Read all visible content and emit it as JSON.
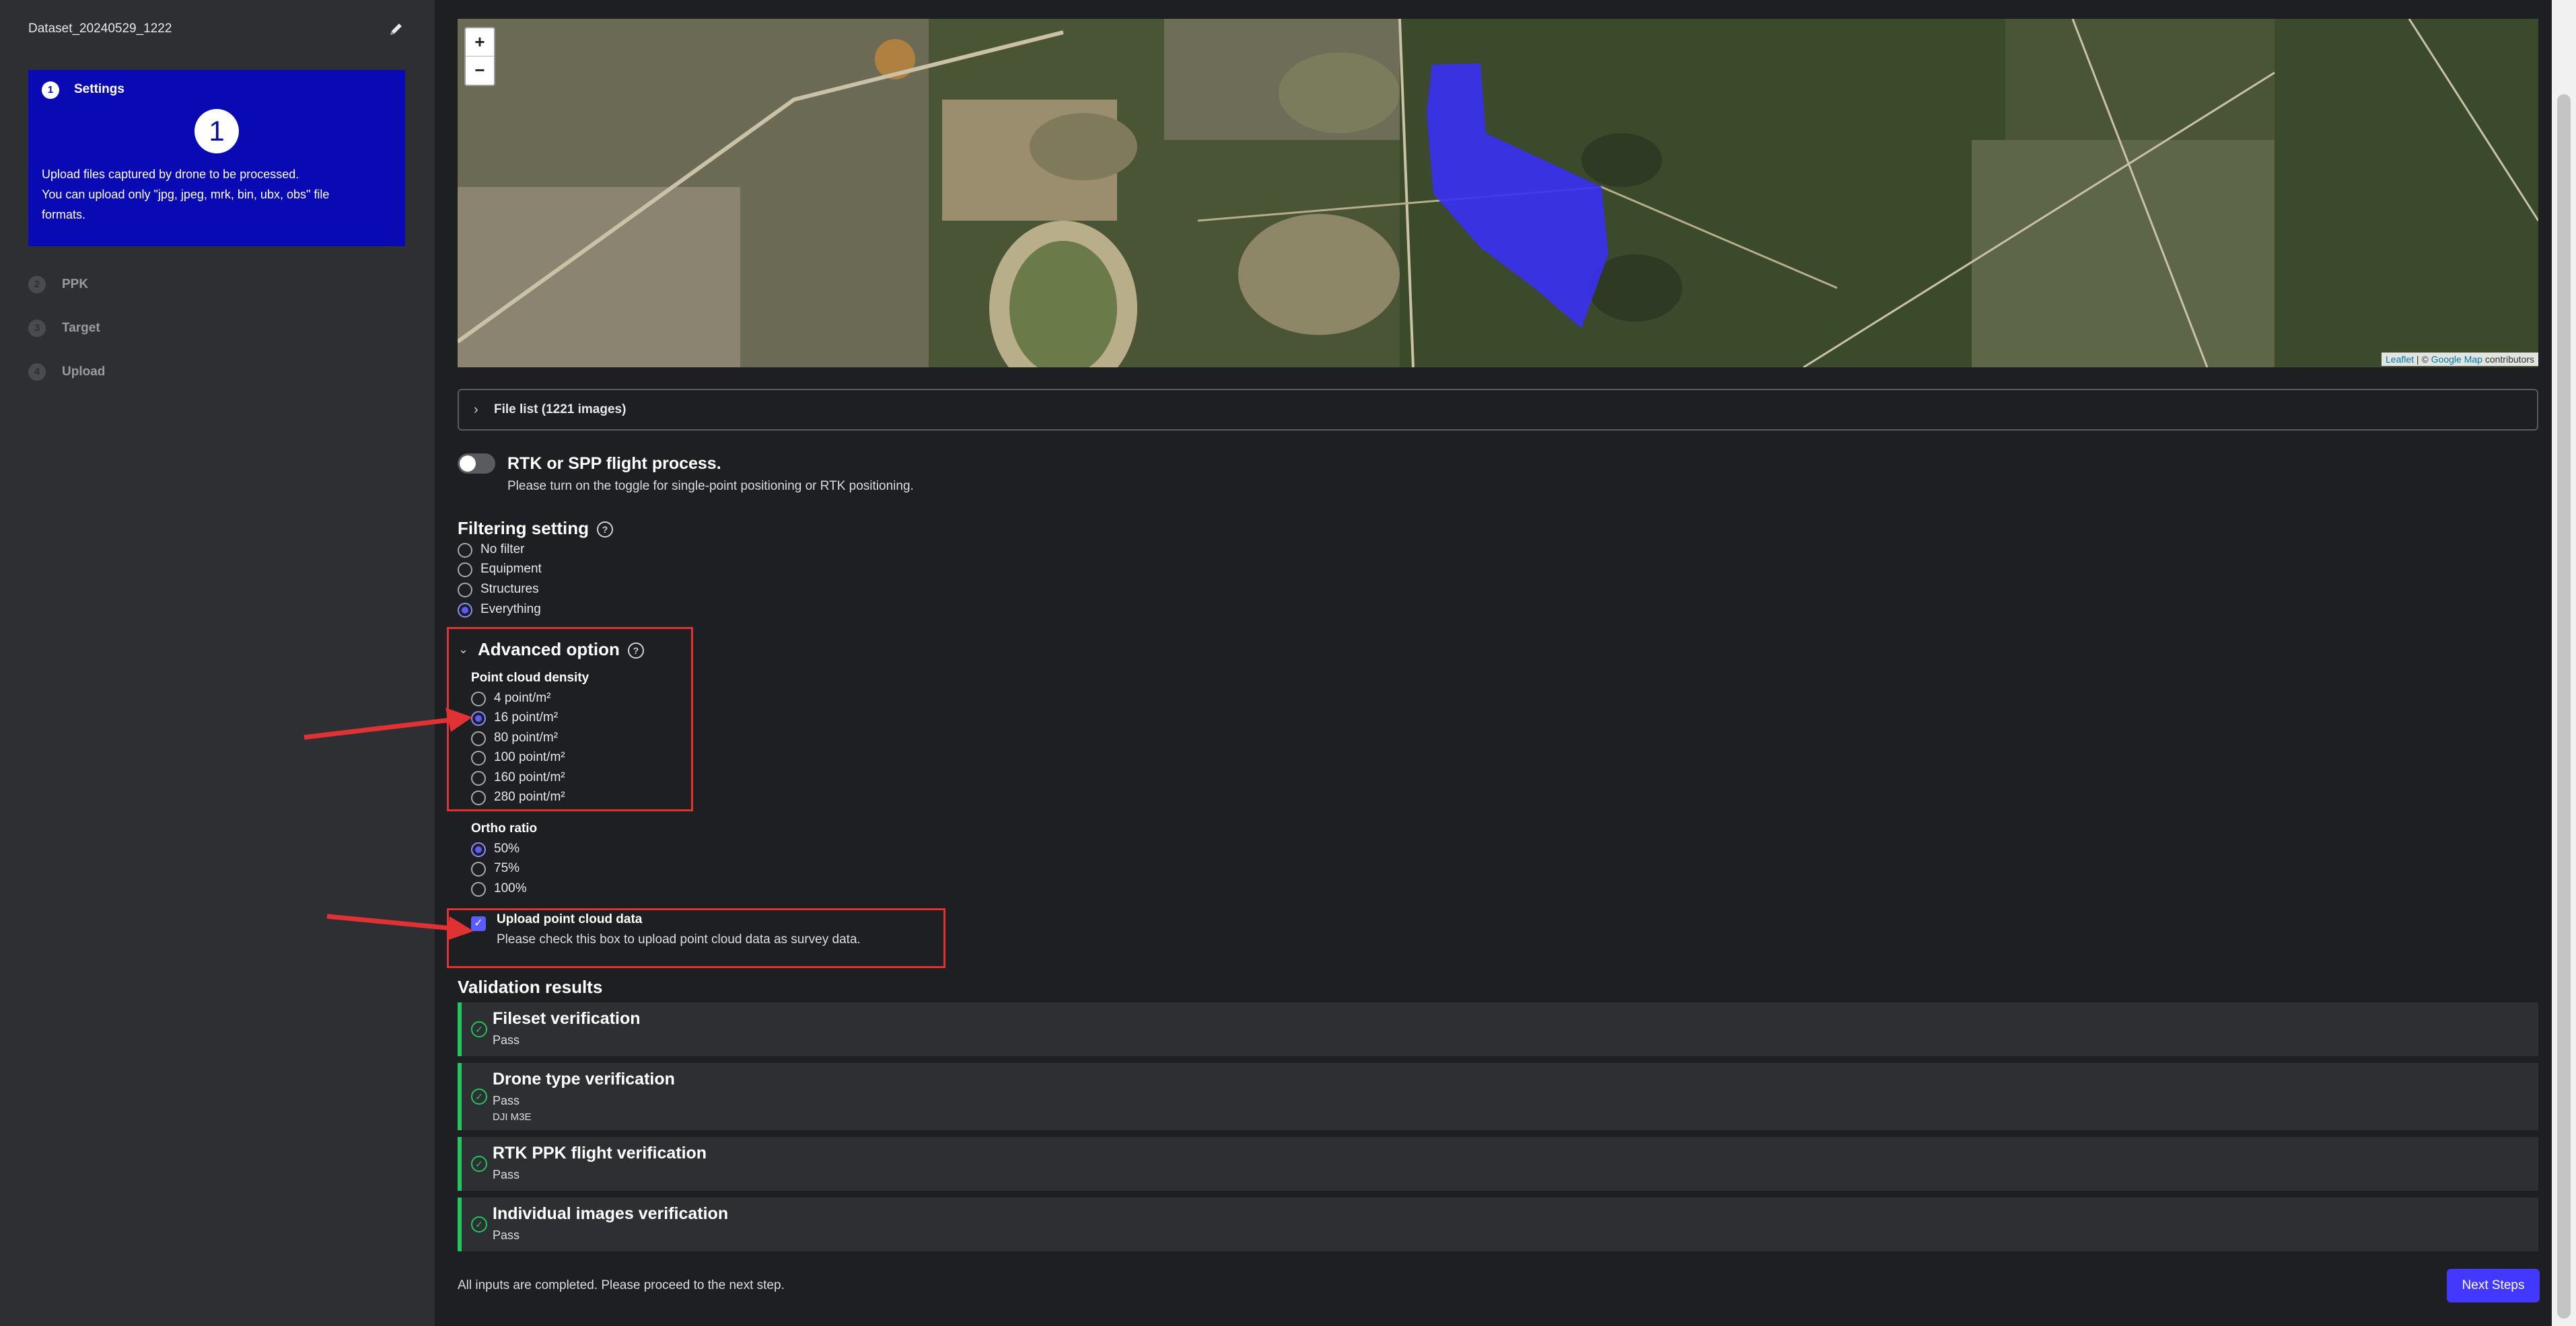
{
  "sidebar": {
    "dataset_name": "Dataset_20240529_1222",
    "active_step": {
      "index": "1",
      "label": "Settings",
      "big_number": "1",
      "description_lines": [
        "Upload files captured by drone to be processed.",
        "You can upload only \"jpg, jpeg, mrk, bin, ubx, obs\" file",
        "formats."
      ]
    },
    "steps": [
      {
        "index": "2",
        "label": "PPK"
      },
      {
        "index": "3",
        "label": "Target"
      },
      {
        "index": "4",
        "label": "Upload"
      }
    ],
    "accent_color": "#0a0ab5"
  },
  "map": {
    "zoom_in": "+",
    "zoom_out": "−",
    "attribution_leaflet": "Leaflet",
    "attribution_sep": " | © ",
    "attribution_google": "Google Map",
    "attribution_rest": " contributors"
  },
  "file_list": {
    "label": "File list (1221 images)"
  },
  "rtk": {
    "title": "RTK or SPP flight process.",
    "subtitle": "Please turn on the toggle for single-point positioning or RTK positioning.",
    "enabled": false
  },
  "filtering": {
    "title": "Filtering setting",
    "options": [
      "No filter",
      "Equipment",
      "Structures",
      "Everything"
    ],
    "selected": "Everything"
  },
  "advanced": {
    "title": "Advanced option",
    "density_title": "Point cloud density",
    "density_options": [
      "4 point/m²",
      "16 point/m²",
      "80 point/m²",
      "100 point/m²",
      "160 point/m²",
      "280 point/m²"
    ],
    "density_selected": "16 point/m²",
    "ortho_title": "Ortho ratio",
    "ortho_options": [
      "50%",
      "75%",
      "100%"
    ],
    "ortho_selected": "50%"
  },
  "upload_point_cloud": {
    "title": "Upload point cloud data",
    "subtitle": "Please check this box to upload point cloud data as survey data.",
    "checked": true
  },
  "validation": {
    "title": "Validation results",
    "items": [
      {
        "title": "Fileset verification",
        "status": "Pass"
      },
      {
        "title": "Drone type verification",
        "status": "Pass",
        "detail": "DJI M3E"
      },
      {
        "title": "RTK PPK flight verification",
        "status": "Pass"
      },
      {
        "title": "Individual images verification",
        "status": "Pass"
      }
    ],
    "pass_color": "#22c55e"
  },
  "footer": {
    "message": "All inputs are completed. Please proceed to the next step.",
    "next_button": "Next Steps"
  }
}
